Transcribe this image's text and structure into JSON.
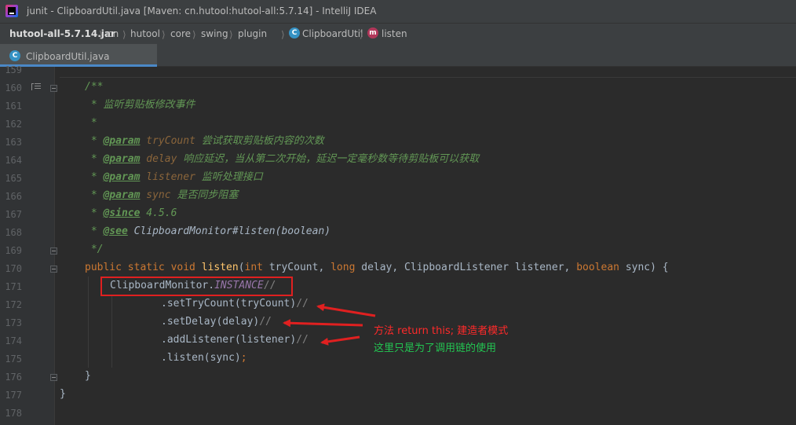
{
  "window": {
    "title": "junit - ClipboardUtil.java [Maven: cn.hutool:hutool-all:5.7.14] - IntelliJ IDEA"
  },
  "breadcrumbs": {
    "items": [
      "hutool-all-5.7.14.jar",
      "cn",
      "hutool",
      "core",
      "swing",
      "plugin",
      "ClipboardUtil",
      "listen"
    ]
  },
  "tabs": [
    {
      "label": "ClipboardUtil.java",
      "icon": "class-icon",
      "active": true
    }
  ],
  "editor": {
    "line_numbers": [
      "159",
      "160",
      "161",
      "162",
      "163",
      "164",
      "165",
      "166",
      "167",
      "168",
      "169",
      "170",
      "171",
      "172",
      "173",
      "174",
      "175",
      "176",
      "177",
      "178"
    ],
    "code": {
      "l160": "/**",
      "l161_star": " * ",
      "l161_text": "监听剪贴板修改事件",
      "l162": " *",
      "l163_star": " * ",
      "l163_tag": "@param",
      "l163_name": "tryCount",
      "l163_desc": " 尝试获取剪贴板内容的次数",
      "l164_tag": "@param",
      "l164_name": "delay",
      "l164_desc": " 响应延迟，当从第二次开始，延迟一定毫秒数等待剪贴板可以获取",
      "l165_tag": "@param",
      "l165_name": "listener",
      "l165_desc": " 监听处理接口",
      "l166_tag": "@param",
      "l166_name": "sync",
      "l166_desc": " 是否同步阻塞",
      "l167_tag": "@since",
      "l167_desc": " 4.5.6",
      "l168_tag": "@see",
      "l168_desc": " ClipboardMonitor#listen(boolean)",
      "l169": " */",
      "l170_kw1": "public static void ",
      "l170_fn": "listen",
      "l170_p1": "(",
      "l170_kw2": "int ",
      "l170_p2": "tryCount, ",
      "l170_kw3": "long ",
      "l170_p3": "delay, ClipboardListener listener, ",
      "l170_kw4": "boolean ",
      "l170_p4": "sync) {",
      "l171_a": "ClipboardMonitor.",
      "l171_b": "INSTANCE",
      "l171_c": "//",
      "l172_a": ".setTryCount(tryCount)",
      "l172_c": "//",
      "l173_a": ".setDelay(delay)",
      "l173_c": "//",
      "l174_a": ".addListener(listener)",
      "l174_c": "//",
      "l175_a": ".listen(sync)",
      "l175_b": ";",
      "l176": "}",
      "l177": "}"
    }
  },
  "annotations": {
    "note1": "方法 return this; 建造者模式",
    "note2": "这里只是为了调用链的使用",
    "note1_color": "#ff2a2a",
    "note2_color": "#23c552",
    "box_color": "#e02020"
  }
}
